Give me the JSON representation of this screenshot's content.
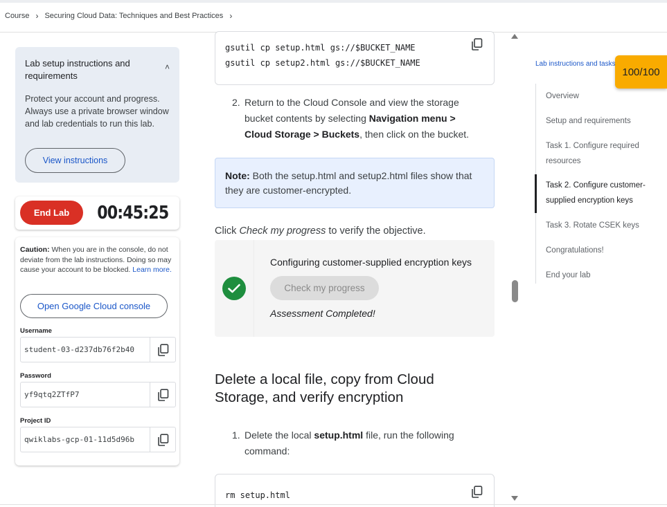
{
  "breadcrumb": {
    "items": [
      "Course",
      "Securing Cloud Data: Techniques and Best Practices"
    ]
  },
  "setup": {
    "title": "Lab setup instructions and requirements",
    "text": "Protect your account and progress. Always use a private browser window and lab credentials to run this lab.",
    "view_button": "View instructions"
  },
  "timer": {
    "end_button": "End Lab",
    "time": "00:45:25"
  },
  "credentials": {
    "caution_label": "Caution:",
    "caution_text": "When you are in the console, do not deviate from the lab instructions. Doing so may cause your account to be blocked.",
    "learn_more": "Learn more.",
    "console_button": "Open Google Cloud console",
    "username_label": "Username",
    "username_value": "student-03-d237db76f2b40",
    "password_label": "Password",
    "password_value": "yf9qtq2ZTfP7",
    "project_label": "Project ID",
    "project_value": "qwiklabs-gcp-01-11d5d96b"
  },
  "content": {
    "code1": [
      "gsutil cp setup.html gs://$BUCKET_NAME",
      "gsutil cp setup2.html gs://$BUCKET_NAME"
    ],
    "step2_num": "2.",
    "step2_a": "Return to the Cloud Console and view the storage bucket contents by selecting ",
    "step2_b": "Navigation menu > Cloud Storage > Buckets",
    "step2_c": ", then click on the bucket.",
    "note_label": "Note:",
    "note_text": " Both the setup.html and setup2.html files show that they are customer-encrypted.",
    "click_a": "Click ",
    "click_em": "Check my progress",
    "click_b": " to verify the objective.",
    "objective_title": "Configuring customer-supplied encryption keys",
    "check_button": "Check my progress",
    "assessment": "Assessment Completed!",
    "heading": "Delete a local file, copy from Cloud Storage, and verify encryption",
    "step1_num": "1.",
    "step1_a": "Delete the local ",
    "step1_b": "setup.html",
    "step1_c": " file, run the following command:",
    "code2": "rm setup.html"
  },
  "toc": {
    "title": "Lab instructions and tasks",
    "score": "100/100",
    "items": [
      "Overview",
      "Setup and requirements",
      "Task 1. Configure required resources",
      "Task 2. Configure customer-supplied encryption keys",
      "Task 3. Rotate CSEK keys",
      "Congratulations!",
      "End your lab"
    ]
  },
  "colors": {
    "accent_blue": "#1a56c8",
    "end_red": "#d93025",
    "success_green": "#1e8e3e",
    "score_amber": "#f9ab00"
  }
}
